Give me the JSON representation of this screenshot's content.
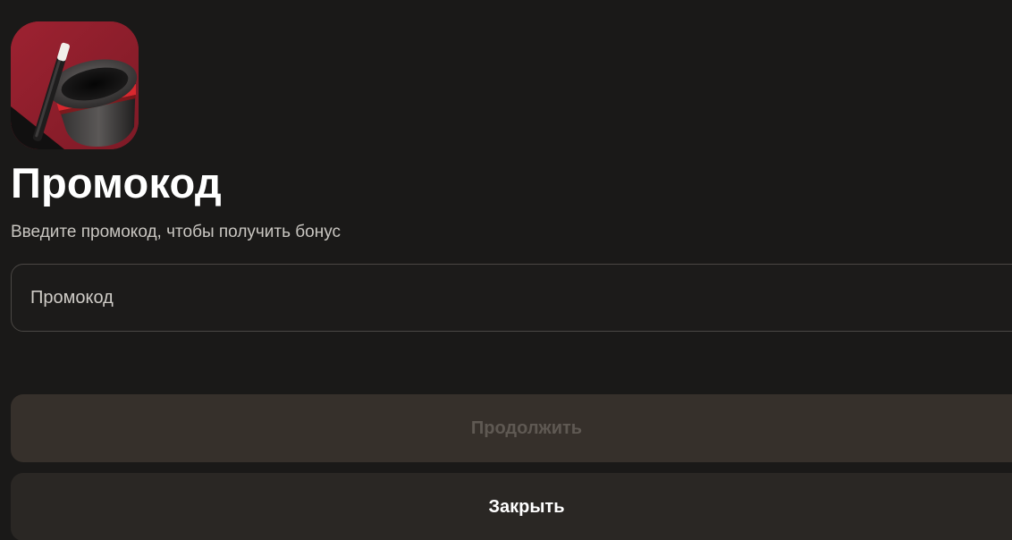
{
  "dialog": {
    "title": "Промокод",
    "subtitle": "Введите промокод, чтобы получить бонус",
    "promo_input": {
      "placeholder": "Промокод",
      "value": ""
    },
    "continue_label": "Продолжить",
    "continue_enabled": false,
    "close_label": "Закрыть"
  },
  "icons": {
    "app_icon": "magic-top-hat-with-wand-icon"
  },
  "colors": {
    "background": "#1a1918",
    "icon_background": "#8f1f2c",
    "hat_band": "#d8282e",
    "continue_button_bg": "#36302b",
    "continue_button_text": "#5f5953",
    "close_button_bg": "#2a2724",
    "close_button_text": "#ffffff",
    "title_text": "#ffffff",
    "subtitle_text": "#c9c6c1"
  }
}
